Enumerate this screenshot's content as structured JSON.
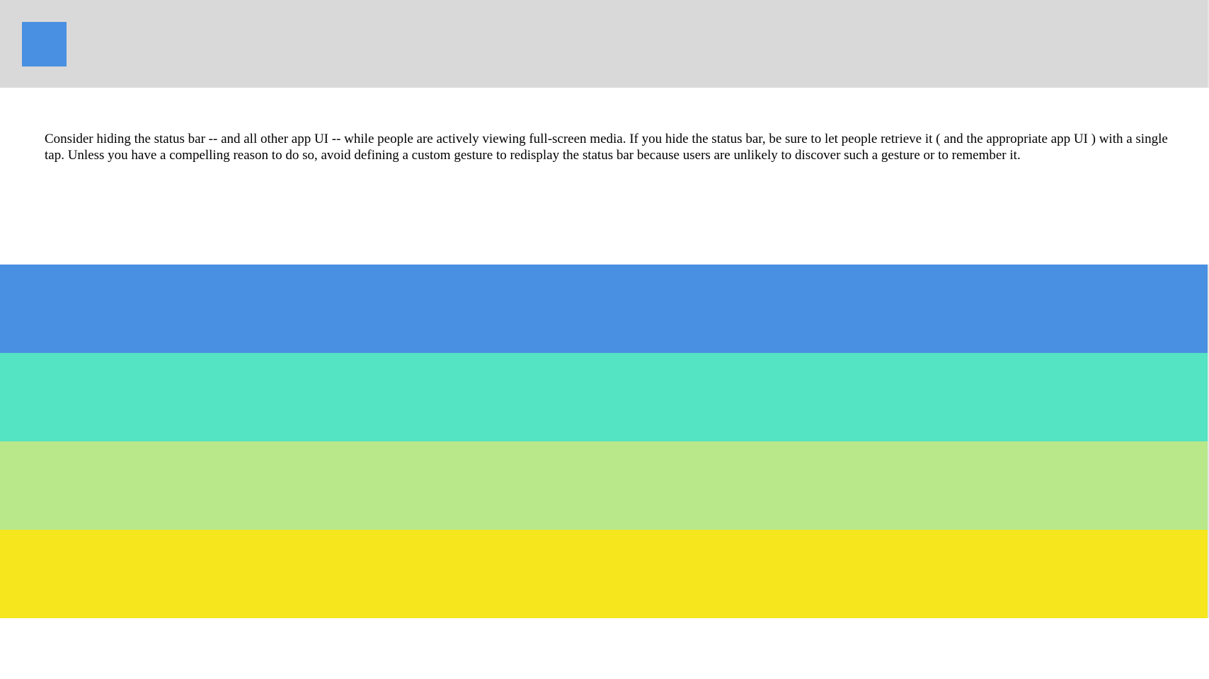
{
  "header": {
    "background": "#d9d9d9",
    "icon": {
      "name": "app-icon",
      "color": "#4a90e2"
    }
  },
  "content": {
    "text": "Consider hiding the status bar -- and all other app UI -- while people are actively viewing full-screen media. If you hide the status bar, be sure to let people retrieve it ( and the appropriate app UI ) with a single tap. Unless you have a compelling reason to do so, avoid defining a custom gesture to redisplay the status bar because users are unlikely to discover such a gesture or to remember it."
  },
  "bands": [
    {
      "name": "blue",
      "color": "#4a90e2"
    },
    {
      "name": "teal",
      "color": "#54e3c3"
    },
    {
      "name": "light-green",
      "color": "#b9e88a"
    },
    {
      "name": "yellow",
      "color": "#f6e61e"
    }
  ]
}
